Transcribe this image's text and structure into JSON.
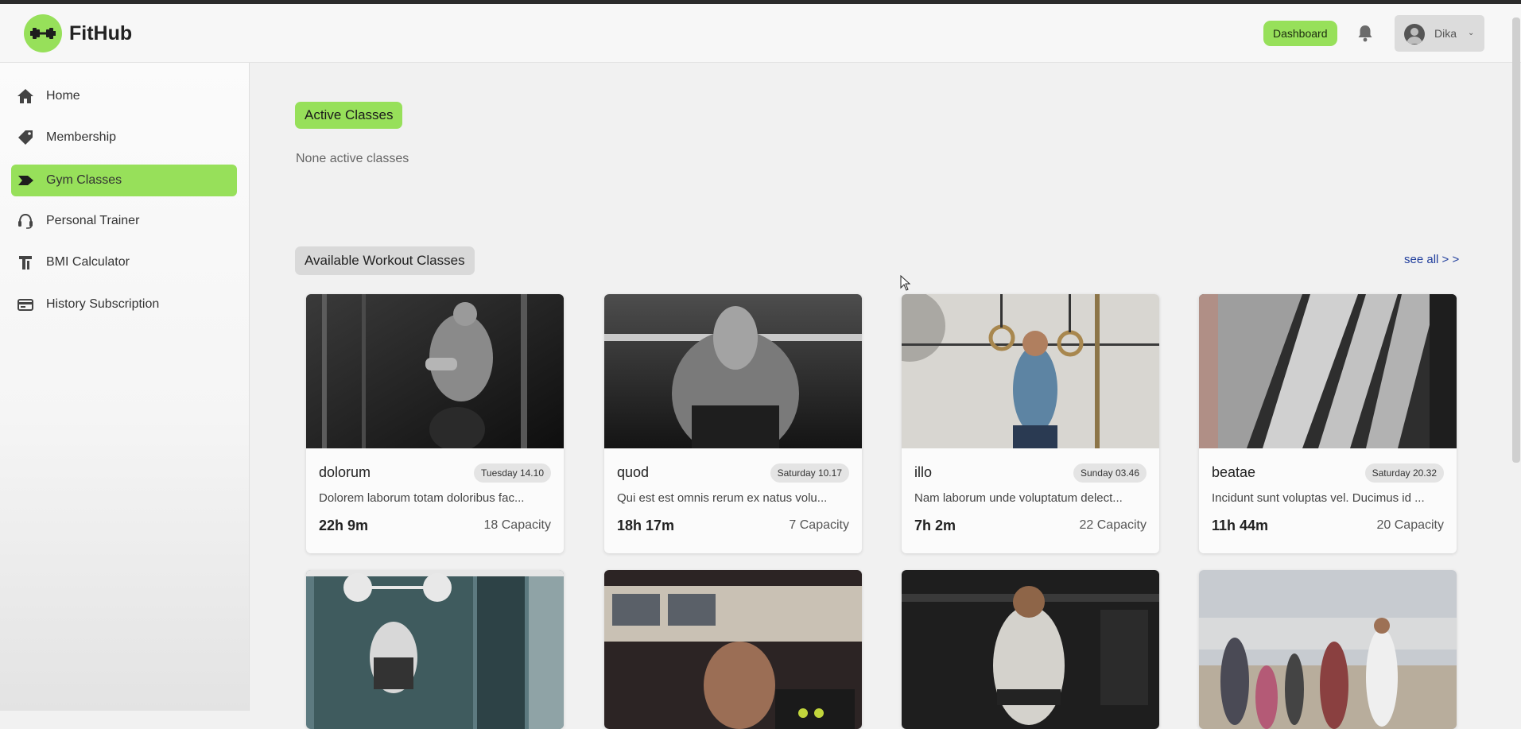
{
  "header": {
    "logo_text": "FitHub",
    "dashboard_label": "Dashboard",
    "user_name": "Dika"
  },
  "sidebar": {
    "items": [
      {
        "label": "Home",
        "icon": "home-icon",
        "active": false
      },
      {
        "label": "Membership",
        "icon": "tag-icon",
        "active": false
      },
      {
        "label": "Gym Classes",
        "icon": "label-arrow-icon",
        "active": true
      },
      {
        "label": "Personal Trainer",
        "icon": "headset-icon",
        "active": false
      },
      {
        "label": "BMI Calculator",
        "icon": "calculator-icon",
        "active": false
      },
      {
        "label": "History Subscription",
        "icon": "card-icon",
        "active": false
      }
    ]
  },
  "main": {
    "active_classes_title": "Active Classes",
    "active_classes_empty": "None active classes",
    "available_title": "Available Workout Classes",
    "see_all": "see all > >",
    "classes": [
      {
        "title": "dolorum",
        "schedule": "Tuesday 14.10",
        "description": "Dolorem laborum totam doloribus fac...",
        "time_left": "22h 9m",
        "capacity": "18 Capacity"
      },
      {
        "title": "quod",
        "schedule": "Saturday 10.17",
        "description": "Qui est est omnis rerum ex natus volu...",
        "time_left": "18h 17m",
        "capacity": "7 Capacity"
      },
      {
        "title": "illo",
        "schedule": "Sunday 03.46",
        "description": "Nam laborum unde voluptatum delect...",
        "time_left": "7h 2m",
        "capacity": "22 Capacity"
      },
      {
        "title": "beatae",
        "schedule": "Saturday 20.32",
        "description": "Incidunt sunt voluptas vel. Ducimus id ...",
        "time_left": "11h 44m",
        "capacity": "20 Capacity"
      }
    ]
  },
  "colors": {
    "accent": "#97e05a",
    "link": "#1f3d9c",
    "background": "#f1f1f1"
  }
}
